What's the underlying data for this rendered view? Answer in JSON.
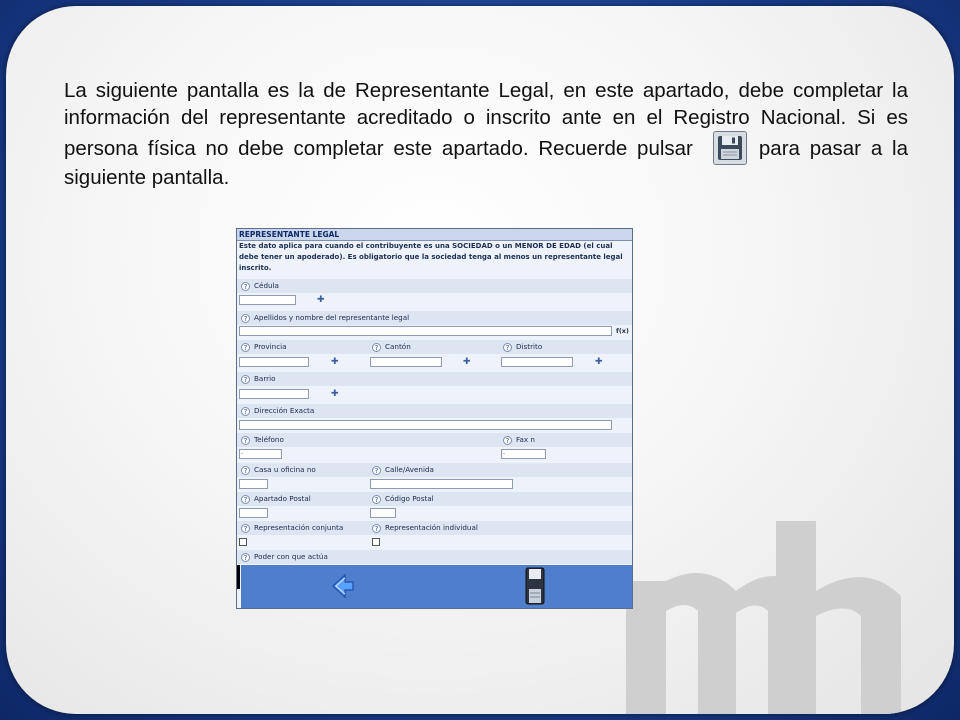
{
  "instructions": {
    "before_icon": "La siguiente pantalla es la de Representante Legal, en este apartado, debe completar la información del representante acreditado o inscrito ante en el Registro Nacional. Si es persona física no debe completar este apartado. Recuerde pulsar",
    "after_icon": "para pasar a la siguiente pantalla."
  },
  "icons": {
    "inline": "floppy-disk-save-icon",
    "watermark": "mh-logo"
  },
  "colors": {
    "outer_frame": "#1b3f8f",
    "form_footer": "#4f7fcc"
  },
  "form": {
    "header": "REPRESENTANTE LEGAL",
    "note": "Este dato aplica para cuando el contribuyente es una SOCIEDAD o un MENOR DE EDAD (el cual debe tener un apoderado). Es obligatorio que la sociedad tenga al menos un representante legal inscrito.",
    "help_glyph": "?",
    "plus_glyph": "✚",
    "fx_label": "f(x)",
    "fields": {
      "cedula": "Cédula",
      "apellidos": "Apellidos y nombre del representante legal",
      "provincia": "Provincia",
      "canton": "Cantón",
      "distrito": "Distrito",
      "barrio": "Barrio",
      "direccion": "Dirección Exacta",
      "telefono": "Teléfono",
      "telefono_value": "-",
      "fax": "Fax n",
      "fax_value": "-",
      "casa": "Casa u oficina no",
      "calle": "Calle/Avenida",
      "apartado": "Apartado Postal",
      "codigo_postal": "Código Postal",
      "rep_conjunta": "Representación conjunta",
      "rep_individual": "Representación individual",
      "poder": "Poder con que actúa"
    }
  }
}
